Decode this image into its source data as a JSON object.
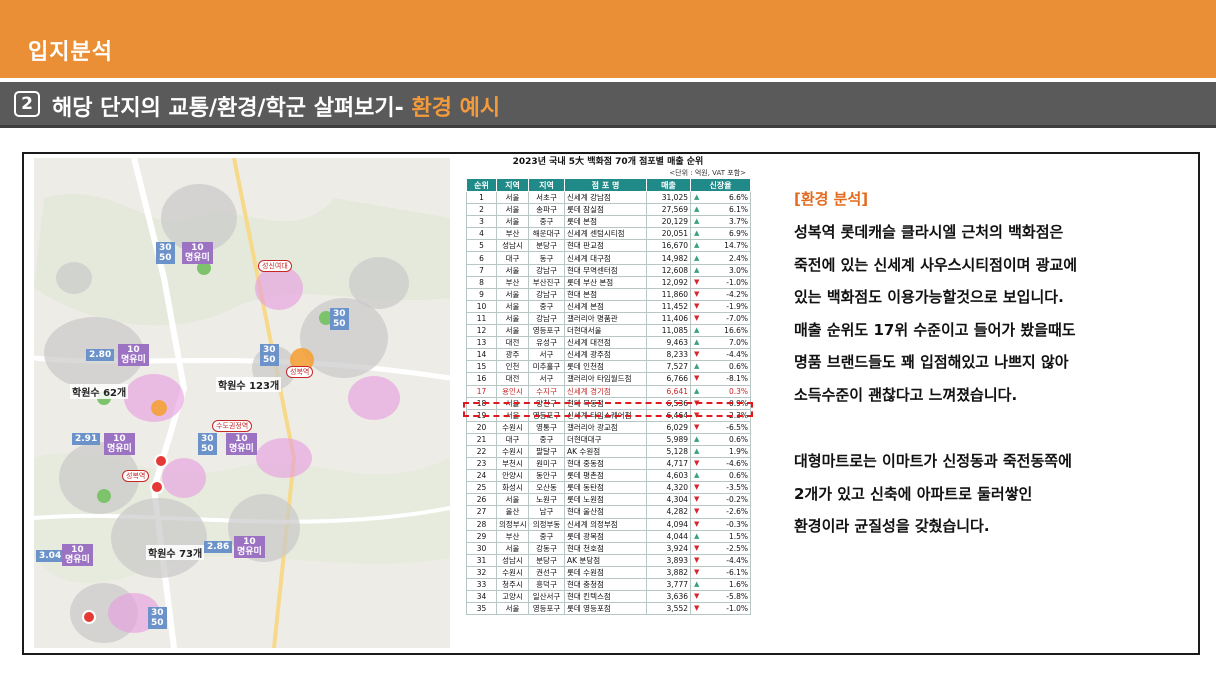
{
  "header": {
    "title": "입지분석"
  },
  "subheader": {
    "number": "2",
    "title": "해당 단지의 교통/환경/학군 살펴보기- ",
    "highlight": "환경 예시"
  },
  "map": {
    "tags": [
      {
        "text": "30\n50",
        "color": "blue"
      },
      {
        "text": "10\n명유미",
        "color": "purple"
      },
      {
        "text": "2.80",
        "color": "blue"
      },
      {
        "text": "10\n명유미",
        "color": "purple"
      },
      {
        "text": "30\n50",
        "color": "blue"
      },
      {
        "text": "30\n50",
        "color": "blue"
      },
      {
        "text": "2.91",
        "color": "blue"
      },
      {
        "text": "10\n명유미",
        "color": "purple"
      },
      {
        "text": "30\n50",
        "color": "blue"
      },
      {
        "text": "10\n명유미",
        "color": "purple"
      },
      {
        "text": "3.04",
        "color": "blue"
      },
      {
        "text": "10\n명유미",
        "color": "purple"
      },
      {
        "text": "2.86",
        "color": "blue"
      },
      {
        "text": "10\n명유미",
        "color": "purple"
      },
      {
        "text": "30\n50",
        "color": "blue"
      }
    ],
    "labels": [
      "학원수 62개",
      "학원수 123개",
      "학원수 73개"
    ],
    "stations": [
      "성신여대",
      "성북역",
      "수도권정역",
      "성복역"
    ],
    "pins": [
      "1",
      "2",
      "3"
    ]
  },
  "ranking": {
    "title": "2023년 국내 5大 백화점 70개 점포별 매출 순위",
    "unit": "<단위 : 억원, VAT 포함>",
    "columns": [
      "순위",
      "지역",
      "지역",
      "점 포 명",
      "매출",
      "신장율"
    ],
    "rows": [
      [
        "1",
        "서울",
        "서초구",
        "신세계 강남점",
        "31,025",
        "up",
        "6.6%"
      ],
      [
        "2",
        "서울",
        "송파구",
        "롯데 잠실점",
        "27,569",
        "up",
        "6.1%"
      ],
      [
        "3",
        "서울",
        "중구",
        "롯데 본점",
        "20,129",
        "up",
        "3.7%"
      ],
      [
        "4",
        "부산",
        "해운대구",
        "신세계 센텀시티점",
        "20,051",
        "up",
        "6.9%"
      ],
      [
        "5",
        "성남시",
        "분당구",
        "현대 판교점",
        "16,670",
        "up",
        "14.7%"
      ],
      [
        "6",
        "대구",
        "동구",
        "신세계 대구점",
        "14,982",
        "up",
        "2.4%"
      ],
      [
        "7",
        "서울",
        "강남구",
        "현대 무역센터점",
        "12,608",
        "up",
        "3.0%"
      ],
      [
        "8",
        "부산",
        "부산진구",
        "롯데 부산 본점",
        "12,092",
        "down",
        "-1.0%"
      ],
      [
        "9",
        "서울",
        "강남구",
        "현대 본점",
        "11,860",
        "down",
        "-4.2%"
      ],
      [
        "10",
        "서울",
        "중구",
        "신세계 본점",
        "11,452",
        "down",
        "-1.9%"
      ],
      [
        "11",
        "서울",
        "강남구",
        "갤러리아 명품관",
        "11,406",
        "down",
        "-7.0%"
      ],
      [
        "12",
        "서울",
        "영등포구",
        "더현대서울",
        "11,085",
        "up",
        "16.6%"
      ],
      [
        "13",
        "대전",
        "유성구",
        "신세계 대전점",
        "9,463",
        "up",
        "7.0%"
      ],
      [
        "14",
        "광주",
        "서구",
        "신세계 광주점",
        "8,233",
        "down",
        "-4.4%"
      ],
      [
        "15",
        "인천",
        "미추홀구",
        "롯데 인천점",
        "7,527",
        "up",
        "0.6%"
      ],
      [
        "16",
        "대전",
        "서구",
        "갤러리아 타임월드점",
        "6,766",
        "down",
        "-8.1%"
      ],
      [
        "17",
        "용인시",
        "수지구",
        "신세계 경기점",
        "6,641",
        "up",
        "0.3%"
      ],
      [
        "18",
        "서울",
        "양천구",
        "현대 목동점",
        "6,536",
        "down",
        "-0.9%"
      ],
      [
        "19",
        "서울",
        "영등포구",
        "신세계 타임스퀘어점",
        "6,464",
        "down",
        "-2.3%"
      ],
      [
        "20",
        "수원시",
        "영통구",
        "갤러리아 광교점",
        "6,029",
        "down",
        "-6.5%"
      ],
      [
        "21",
        "대구",
        "중구",
        "더현대대구",
        "5,989",
        "up",
        "0.6%"
      ],
      [
        "22",
        "수원시",
        "팔달구",
        "AK 수원점",
        "5,128",
        "up",
        "1.9%"
      ],
      [
        "23",
        "부천시",
        "원미구",
        "현대 중동점",
        "4,717",
        "down",
        "-4.6%"
      ],
      [
        "24",
        "안양시",
        "동안구",
        "롯데 평촌점",
        "4,603",
        "up",
        "0.6%"
      ],
      [
        "25",
        "화성시",
        "오산동",
        "롯데 동탄점",
        "4,320",
        "down",
        "-3.5%"
      ],
      [
        "26",
        "서울",
        "노원구",
        "롯데 노원점",
        "4,304",
        "down",
        "-0.2%"
      ],
      [
        "27",
        "울산",
        "남구",
        "현대 울산점",
        "4,282",
        "down",
        "-2.6%"
      ],
      [
        "28",
        "의정부시",
        "의정부동",
        "신세계 의정부점",
        "4,094",
        "down",
        "-0.3%"
      ],
      [
        "29",
        "부산",
        "중구",
        "롯데 광복점",
        "4,044",
        "up",
        "1.5%"
      ],
      [
        "30",
        "서울",
        "강동구",
        "현대 천호점",
        "3,924",
        "down",
        "-2.5%"
      ],
      [
        "31",
        "성남시",
        "분당구",
        "AK 분당점",
        "3,893",
        "down",
        "-4.4%"
      ],
      [
        "32",
        "수원시",
        "권선구",
        "롯데 수원점",
        "3,882",
        "down",
        "-6.1%"
      ],
      [
        "33",
        "청주시",
        "흥덕구",
        "현대 충청점",
        "3,777",
        "up",
        "1.6%"
      ],
      [
        "34",
        "고양시",
        "일산서구",
        "현대 킨텍스점",
        "3,636",
        "down",
        "-5.8%"
      ],
      [
        "35",
        "서울",
        "영등포구",
        "롯데 영등포점",
        "3,552",
        "down",
        "-1.0%"
      ]
    ],
    "highlight_rank": "17"
  },
  "analysis": {
    "heading": "[환경 분석]",
    "paragraph1": [
      "성복역 롯데캐슬 클라시엘 근처의 백화점은",
      "죽전에 있는 신세계 사우스시티점이며 광교에",
      "있는 백화점도 이용가능할것으로 보입니다.",
      "매출 순위도 17위 수준이고 들어가 봤을때도",
      "명품 브랜드들도 꽤 입점해있고 나쁘지 않아",
      "소득수준이 괜찮다고 느껴졌습니다."
    ],
    "paragraph2": [
      "대형마트로는 이마트가 신정동과 죽전동쪽에",
      "2개가 있고 신축에 아파트로 둘러쌓인",
      "환경이라 균질성을 갖췄습니다."
    ]
  },
  "colors": {
    "accent": "#ea8f35",
    "subbar": "#5a5a5a",
    "table_header": "#1f8a87",
    "highlight": "#e0191e",
    "up": "#38a37a",
    "down": "#d9262e"
  }
}
